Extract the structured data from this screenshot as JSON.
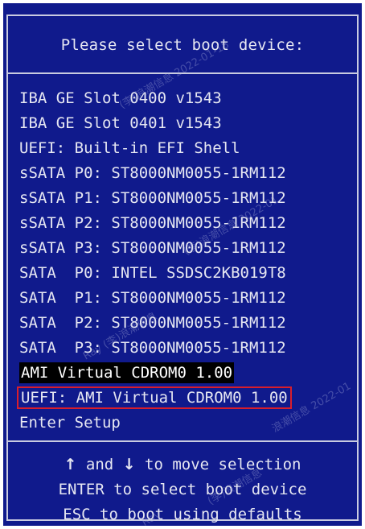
{
  "title": "Please select boot device:",
  "boot_devices": [
    {
      "label": "IBA GE Slot 0400 v1543"
    },
    {
      "label": "IBA GE Slot 0401 v1543"
    },
    {
      "label": "UEFI: Built-in EFI Shell"
    },
    {
      "label": "sSATA P0: ST8000NM0055-1RM112"
    },
    {
      "label": "sSATA P1: ST8000NM0055-1RM112"
    },
    {
      "label": "sSATA P2: ST8000NM0055-1RM112"
    },
    {
      "label": "sSATA P3: ST8000NM0055-1RM112"
    },
    {
      "label": "SATA  P0: INTEL SSDSC2KB019T8"
    },
    {
      "label": "SATA  P1: ST8000NM0055-1RM112"
    },
    {
      "label": "SATA  P2: ST8000NM0055-1RM112"
    },
    {
      "label": "SATA  P3: ST8000NM0055-1RM112"
    },
    {
      "label": "AMI Virtual CDROM0 1.00"
    },
    {
      "label": "UEFI: AMI Virtual CDROM0 1.00"
    },
    {
      "label": "Enter Setup"
    }
  ],
  "help": {
    "line1_arrow_up": "↑",
    "line1_mid": " and ",
    "line1_arrow_down": "↓",
    "line1_end": " to move selection",
    "line2": "ENTER to select boot device",
    "line3": "ESC to boot using defaults"
  },
  "watermarks": {
    "w1": "(李)浪潮信息 2022-01-18",
    "w2": "(李)浪潮信息 2022-01",
    "w3": "Ray (李)浪潮信息",
    "w4": "浪潮信息 2022-01",
    "w5": "(李)浪潮信息",
    "w6": "Ray"
  },
  "colors": {
    "background": "#101a8c",
    "text": "#e6e7f2",
    "highlight_bg": "#000000",
    "outline": "#d81e2c"
  }
}
